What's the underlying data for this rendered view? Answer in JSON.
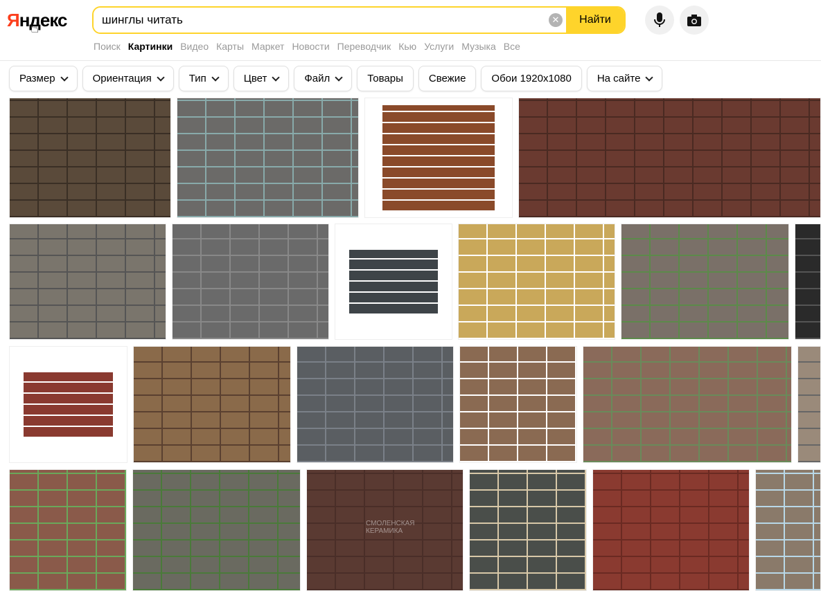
{
  "header": {
    "logo": {
      "first": "Я",
      "rest": "ндекс"
    },
    "search": {
      "value": "шинглы читать",
      "find_label": "Найти"
    },
    "nav": [
      "Поиск",
      "Картинки",
      "Видео",
      "Карты",
      "Маркет",
      "Новости",
      "Переводчик",
      "Кью",
      "Услуги",
      "Музыка",
      "Все"
    ],
    "active_nav": "Картинки"
  },
  "filters": [
    {
      "label": "Размер",
      "dropdown": true
    },
    {
      "label": "Ориентация",
      "dropdown": true
    },
    {
      "label": "Тип",
      "dropdown": true
    },
    {
      "label": "Цвет",
      "dropdown": true
    },
    {
      "label": "Файл",
      "dropdown": true
    },
    {
      "label": "Товары",
      "dropdown": false
    },
    {
      "label": "Свежие",
      "dropdown": false
    },
    {
      "label": "Обои 1920x1080",
      "dropdown": false
    },
    {
      "label": "На сайте",
      "dropdown": true
    }
  ],
  "watermark_text": "СМОЛЕНСКАЯ КЕРАМИКА",
  "colors": {
    "accent": "#fed42b",
    "logo_red": "#fc3f1d"
  }
}
